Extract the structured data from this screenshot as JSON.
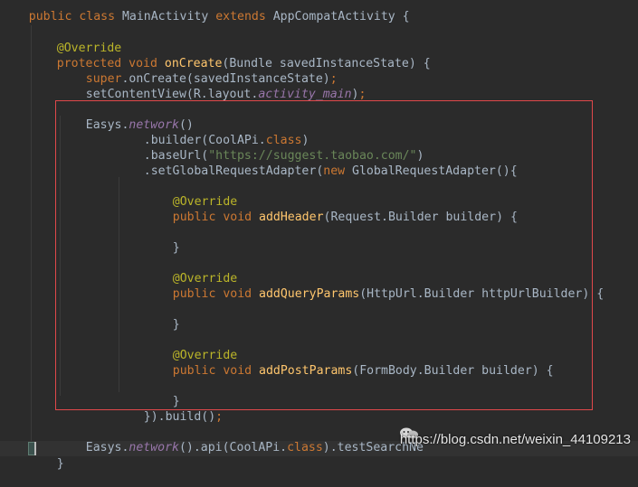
{
  "editor": {
    "lines": {
      "l0": {
        "public": "public ",
        "class": "class ",
        "name": "MainActivity ",
        "extends": "extends ",
        "parent": "AppCompatActivity {"
      },
      "l1": {
        "override": "@Override"
      },
      "l2": {
        "protected": "protected ",
        "void": "void ",
        "method": "onCreate",
        "args": "(Bundle savedInstanceState) {"
      },
      "l3": {
        "super": "super",
        "rest": ".onCreate(savedInstanceState)",
        "semi": ";"
      },
      "l4": {
        "call": "setContentView(R.layout.",
        "field": "activity_main",
        "close": ")",
        "semi": ";"
      },
      "l5": {
        "obj": "Easys.",
        "method": "network",
        "rest": "()"
      },
      "l6": {
        "pre": ".builder(CoolAPi.",
        "class": "class",
        "close": ")"
      },
      "l7": {
        "pre": ".baseUrl(",
        "str": "\"https://suggest.taobao.com/\"",
        "close": ")"
      },
      "l8": {
        "pre": ".setGlobalRequestAdapter(",
        "new": "new ",
        "rest": "GlobalRequestAdapter(){"
      },
      "l9": {
        "override": "@Override"
      },
      "l10": {
        "public": "public ",
        "void": "void ",
        "method": "addHeader",
        "args": "(Request.Builder builder) {"
      },
      "l11": {
        "brace": "}"
      },
      "l12": {
        "override": "@Override"
      },
      "l13": {
        "public": "public ",
        "void": "void ",
        "method": "addQueryParams",
        "args": "(HttpUrl.Builder httpUrlBuilder) {"
      },
      "l14": {
        "brace": "}"
      },
      "l15": {
        "override": "@Override"
      },
      "l16": {
        "public": "public ",
        "void": "void ",
        "method": "addPostParams",
        "args": "(FormBody.Builder builder) {"
      },
      "l17": {
        "brace": "}"
      },
      "l18": {
        "rest": "}).build()",
        "semi": ";"
      },
      "l19": {
        "obj": "Easys.",
        "method": "network",
        "pre": "().api(CoolAPi.",
        "class": "class",
        "rest": ").testSearchNe"
      },
      "l20": {
        "brace": "}"
      }
    },
    "watermark": "https://blog.csdn.net/weixin_44109213",
    "colors": {
      "background": "#2b2b2b",
      "keyword": "#cc7832",
      "annotation": "#bbb529",
      "method": "#ffc66d",
      "string": "#6a8759",
      "field": "#9876aa",
      "highlight_box": "#e0484b"
    }
  }
}
